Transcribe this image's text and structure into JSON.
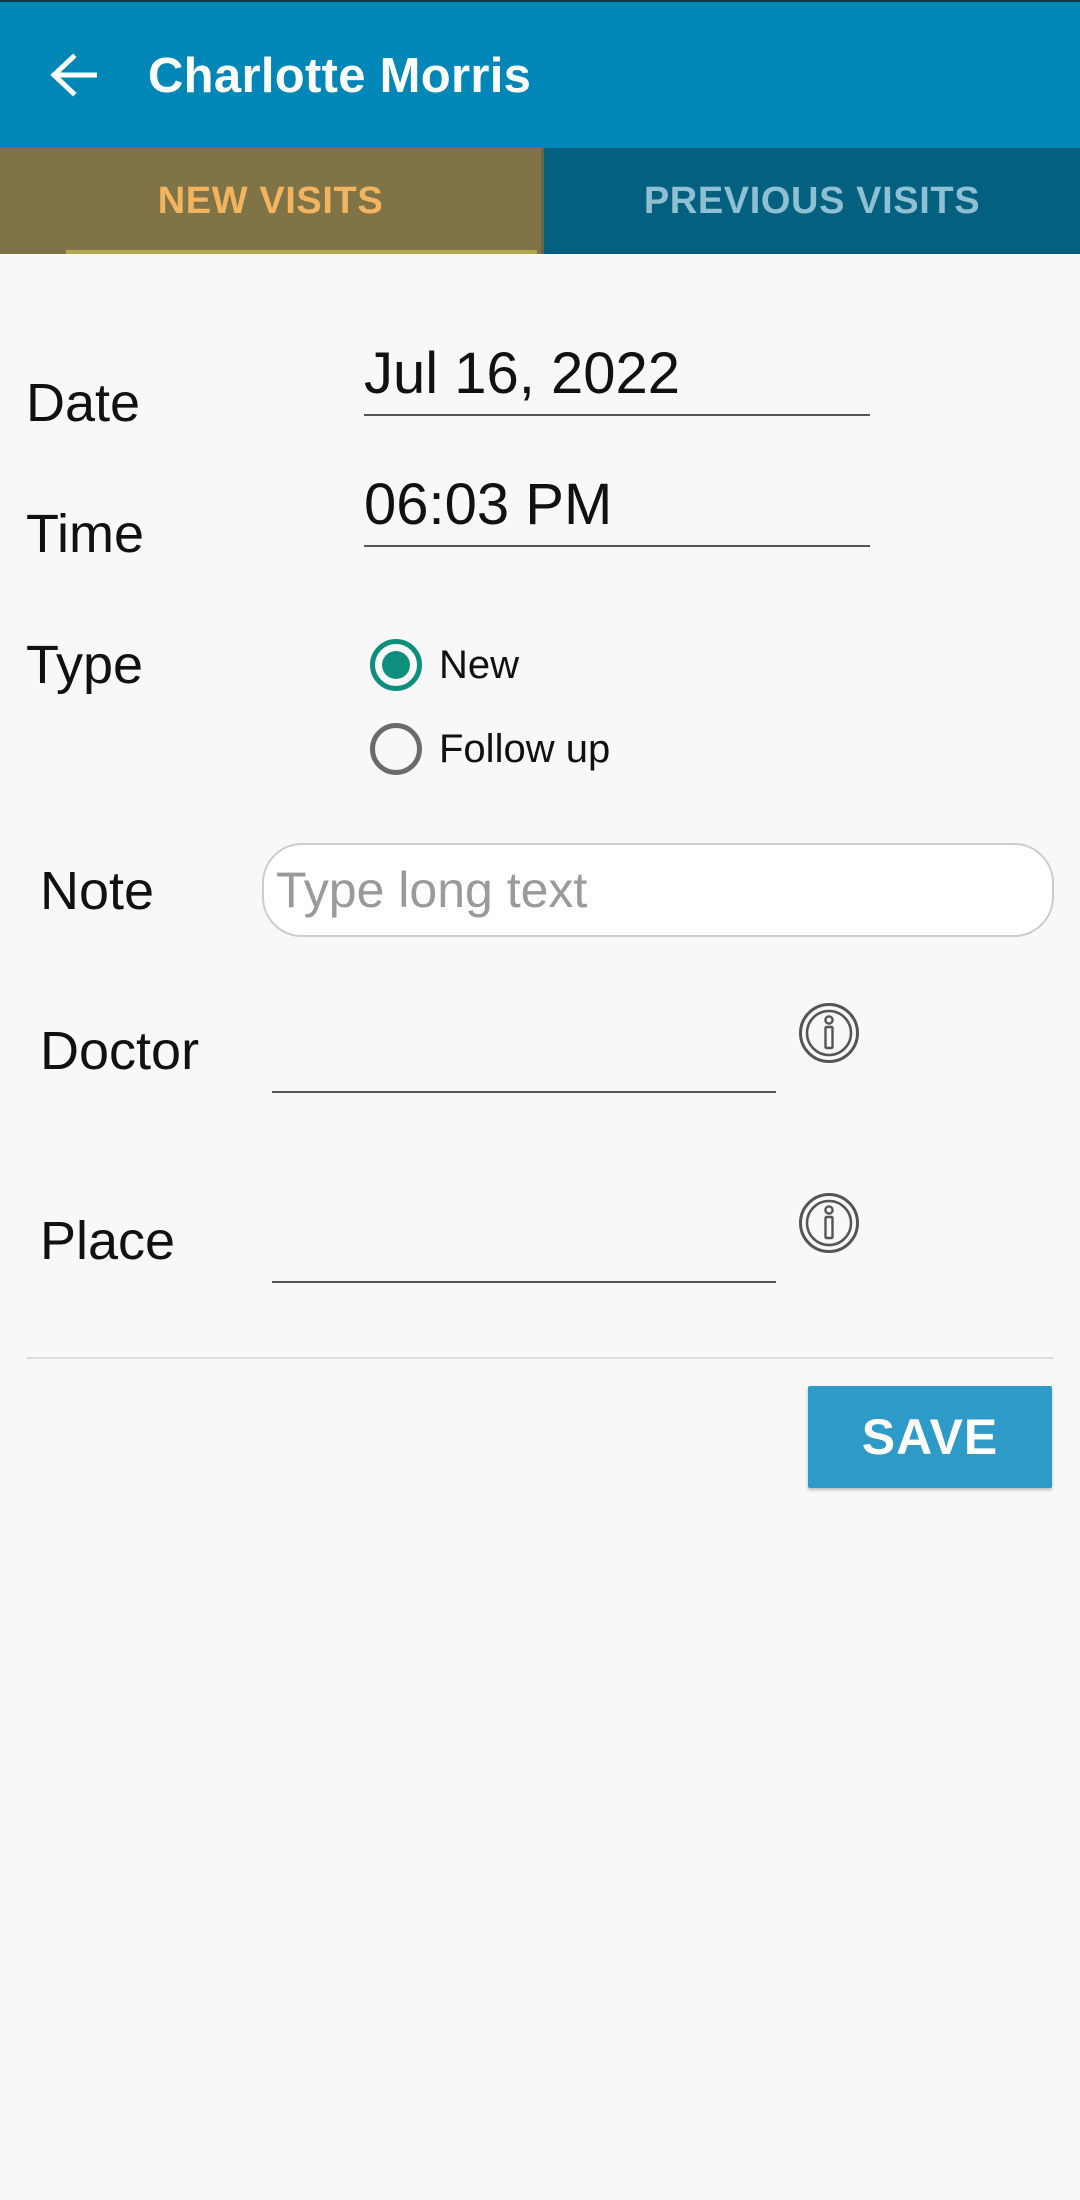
{
  "app_bar": {
    "title": "Charlotte Morris",
    "back_icon": "arrow-left-icon"
  },
  "tabs": [
    {
      "label": "NEW VISITS",
      "selected": true
    },
    {
      "label": "PREVIOUS VISITS",
      "selected": false
    }
  ],
  "form": {
    "date": {
      "label": "Date",
      "value": "Jul 16, 2022"
    },
    "time": {
      "label": "Time",
      "value": "06:03 PM"
    },
    "type": {
      "label": "Type",
      "options": [
        {
          "label": "New",
          "checked": true
        },
        {
          "label": "Follow up",
          "checked": false
        }
      ]
    },
    "note": {
      "label": "Note",
      "value": "",
      "placeholder": "Type long text"
    },
    "doctor": {
      "label": "Doctor",
      "value": "",
      "info_icon": "info-circle-icon"
    },
    "place": {
      "label": "Place",
      "value": "",
      "info_icon": "info-circle-icon"
    }
  },
  "actions": {
    "save_label": "SAVE"
  },
  "colors": {
    "app_bar": "#0087b8",
    "tab_selected_bg": "#807447",
    "tab_selected_text": "#f3b45f",
    "tab_unselected_bg": "#03607f",
    "tab_unselected_text": "#8fbfd2",
    "radio_accent": "#0e8f7e",
    "save_button": "#2e9ac7"
  }
}
